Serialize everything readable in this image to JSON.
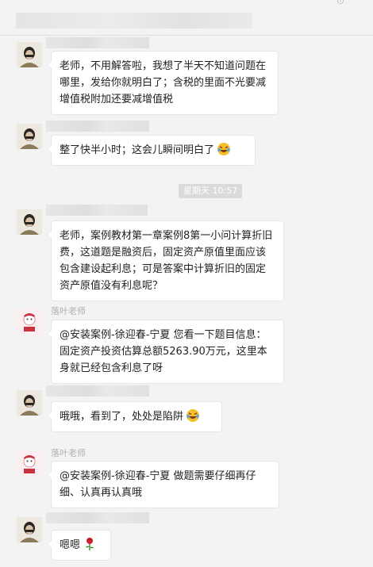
{
  "header": {
    "title_blurred": true,
    "corner_glyph": "⊙"
  },
  "separator": {
    "timestamp": "星期天 10:57"
  },
  "messages": [
    {
      "sender": "",
      "text": "老师，不用解答啦，我想了半天不知道问题在哪里，发给你就明白了；含税的里面不光要减增值税附加还要减增值税"
    },
    {
      "sender": "",
      "text": "整了快半小时；这会儿瞬间明白了",
      "emoji": "grinning-tears-emoji"
    },
    {
      "sender": "",
      "text": "老师，案例教材第一章案例8第一小问计算折旧费，这道题是融资后，固定资产原值里面应该包含建设起利息；可是答案中计算折旧的固定资产原值没有利息呢？"
    },
    {
      "sender": "落叶老师",
      "text": "@安装案例-徐迎春-宁夏 您看一下题目信息：固定资产投资估算总额5263.90万元，这里本身就已经包含利息了呀"
    },
    {
      "sender": "",
      "text": "哦哦，看到了，处处是陷阱",
      "emoji": "grinning-tears-emoji"
    },
    {
      "sender": "落叶老师",
      "text": "@安装案例-徐迎春-宁夏 做题需要仔细再仔细、认真再认真哦"
    },
    {
      "sender": "",
      "text": "嗯嗯",
      "emoji": "rose-emoji"
    }
  ],
  "colors": {
    "background": "#f3f3f3",
    "bubble": "#ffffff",
    "timestamp_bg": "#dadada",
    "sender_name": "#b0b0b0"
  }
}
